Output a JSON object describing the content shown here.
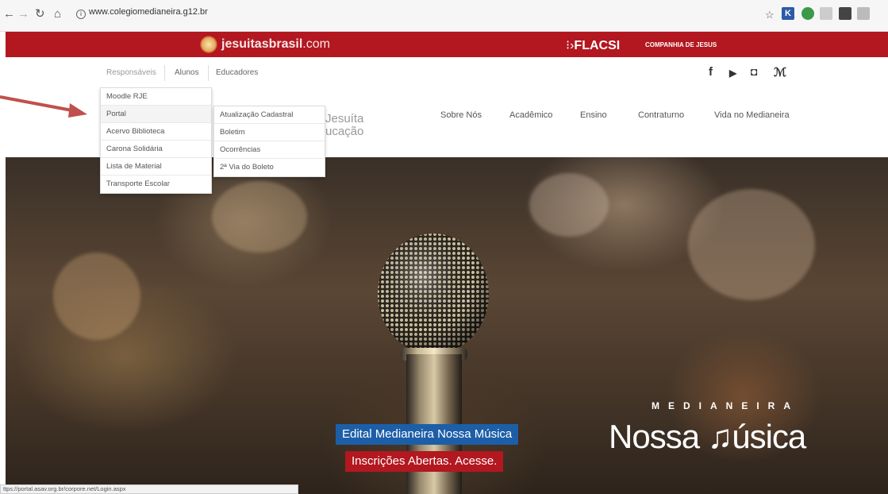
{
  "browser": {
    "url": "www.colegiomedianeira.g12.br",
    "status_url": "ttps://portal.asav.org.br/corpore.net/Login.aspx"
  },
  "topbar": {
    "brand_main": "jesuitasbrasil",
    "brand_suffix": ".com",
    "flacsi": "FLACSI",
    "companhia": "COMPANHIA DE JESUS"
  },
  "user_nav": [
    "Responsáveis",
    "Alunos",
    "Educadores"
  ],
  "social": {
    "facebook": "f",
    "youtube": "▶",
    "instagram": "◘",
    "other": "ℳ"
  },
  "school": {
    "line1": "Jesuíta",
    "line2": "ucação"
  },
  "main_nav": [
    "Sobre Nós",
    "Acadêmico",
    "Ensino",
    "Contraturno",
    "Vida no Medianeira"
  ],
  "dropdown_responsaveis": [
    "Moodle RJE",
    "Portal",
    "Acervo Biblioteca",
    "Carona Solidária",
    "Lista de Material",
    "Transporte Escolar"
  ],
  "dropdown_portal": [
    "Atualização Cadastral",
    "Boletim",
    "Ocorrências",
    "2ª Via do Boleto"
  ],
  "hero": {
    "edital": "Edital Medianeira Nossa Música",
    "inscricoes": "Inscrições Abertas. Acesse.",
    "medianeira": "MEDIANEIRA",
    "nossa_musica": "Nossa ♫úsica"
  },
  "colors": {
    "brand_red": "#b3171f",
    "label_blue": "#1d5ea8",
    "arrow": "#c0504d"
  }
}
